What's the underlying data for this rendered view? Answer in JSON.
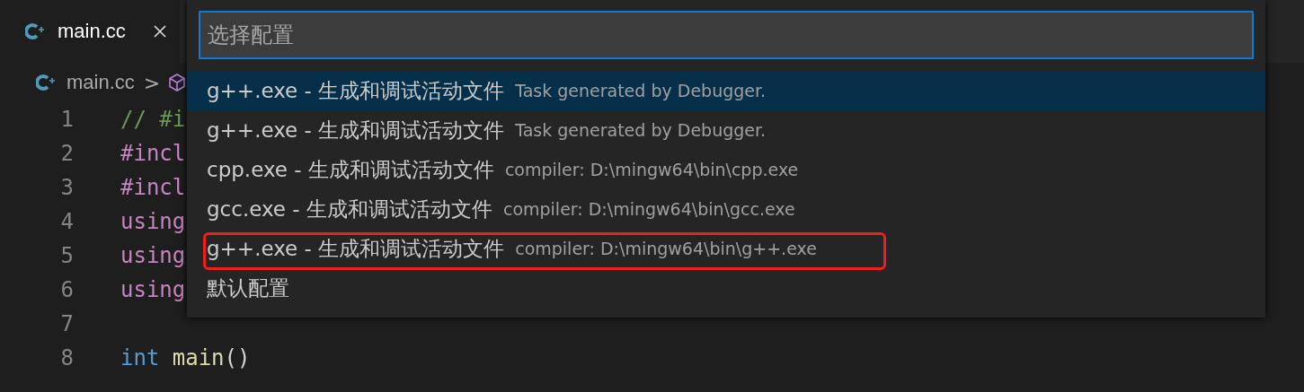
{
  "tab": {
    "label": "main.cc",
    "selected": true
  },
  "breadcrumb": {
    "file": "main.cc",
    "separator": ">"
  },
  "code_lines": [
    {
      "number": "1",
      "tokens": [
        {
          "kind": "comment",
          "text": "// #i"
        }
      ]
    },
    {
      "number": "2",
      "tokens": [
        {
          "kind": "directive",
          "text": "#incl"
        }
      ]
    },
    {
      "number": "3",
      "tokens": [
        {
          "kind": "directive",
          "text": "#incl"
        }
      ]
    },
    {
      "number": "4",
      "tokens": [
        {
          "kind": "keyword",
          "text": "using"
        }
      ]
    },
    {
      "number": "5",
      "tokens": [
        {
          "kind": "keyword",
          "text": "using"
        }
      ]
    },
    {
      "number": "6",
      "tokens": [
        {
          "kind": "keyword",
          "text": "using"
        }
      ]
    },
    {
      "number": "7"
    },
    {
      "number": "8",
      "tokens": [
        {
          "kind": "type",
          "text": "int"
        },
        {
          "kind": "function",
          "text": "main",
          "spaced": true
        },
        {
          "kind": "plain",
          "text": "()"
        }
      ]
    }
  ],
  "quick_pick": {
    "placeholder": "选择配置",
    "items": [
      {
        "label": "g++.exe - 生成和调试活动文件",
        "description": "Task generated by Debugger.",
        "selected": true,
        "annotated": false
      },
      {
        "label": "g++.exe - 生成和调试活动文件",
        "description": "Task generated by Debugger.",
        "selected": false,
        "annotated": false
      },
      {
        "label": "cpp.exe - 生成和调试活动文件",
        "description": "compiler: D:\\mingw64\\bin\\cpp.exe",
        "selected": false,
        "annotated": false
      },
      {
        "label": "gcc.exe - 生成和调试活动文件",
        "description": "compiler: D:\\mingw64\\bin\\gcc.exe",
        "selected": false,
        "annotated": false
      },
      {
        "label": "g++.exe - 生成和调试活动文件",
        "description": "compiler: D:\\mingw64\\bin\\g++.exe",
        "selected": false,
        "annotated": true
      },
      {
        "label": "默认配置",
        "selected": false,
        "annotated": false
      }
    ]
  }
}
